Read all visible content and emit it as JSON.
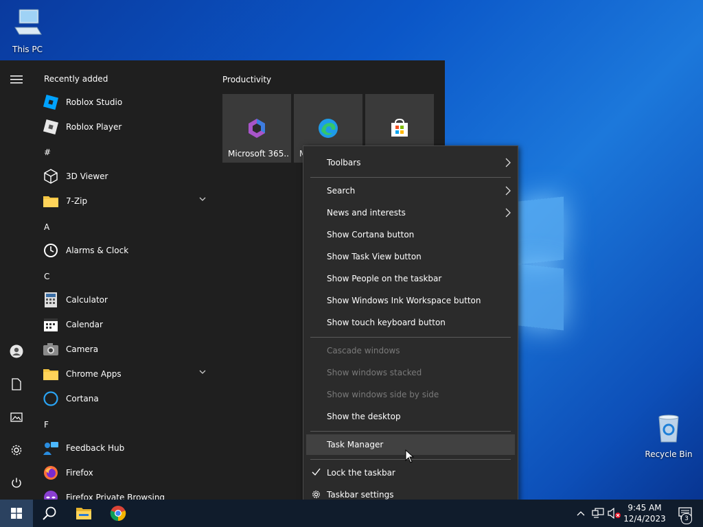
{
  "desktop": {
    "this_pc_label": "This PC",
    "recycle_bin_label": "Recycle Bin"
  },
  "start_menu": {
    "recently_added_header": "Recently added",
    "apps": [
      {
        "label": "Roblox Studio",
        "icon": "roblox-studio-icon"
      },
      {
        "label": "Roblox Player",
        "icon": "roblox-player-icon"
      },
      {
        "header": "#"
      },
      {
        "label": "3D Viewer",
        "icon": "cube-icon"
      },
      {
        "label": "7-Zip",
        "icon": "folder-icon",
        "expandable": true
      },
      {
        "header": "A"
      },
      {
        "label": "Alarms & Clock",
        "icon": "clock-icon"
      },
      {
        "header": "C"
      },
      {
        "label": "Calculator",
        "icon": "calculator-icon"
      },
      {
        "label": "Calendar",
        "icon": "calendar-icon"
      },
      {
        "label": "Camera",
        "icon": "camera-icon"
      },
      {
        "label": "Chrome Apps",
        "icon": "folder-icon",
        "expandable": true
      },
      {
        "label": "Cortana",
        "icon": "cortana-icon"
      },
      {
        "header": "F"
      },
      {
        "label": "Feedback Hub",
        "icon": "feedback-icon"
      },
      {
        "label": "Firefox",
        "icon": "firefox-icon"
      },
      {
        "label": "Firefox Private Browsing",
        "icon": "firefox-private-icon"
      }
    ],
    "tiles_group_title": "Productivity",
    "tiles": [
      {
        "label": "Microsoft 365...",
        "icon": "microsoft-365-icon"
      },
      {
        "label": "M",
        "icon": "edge-icon"
      },
      {
        "label": "",
        "icon": "store-icon"
      }
    ]
  },
  "context_menu": {
    "items": [
      {
        "label": "Toolbars",
        "submenu": true
      },
      {
        "label": "Search",
        "submenu": true
      },
      {
        "label": "News and interests",
        "submenu": true
      },
      {
        "label": "Show Cortana button"
      },
      {
        "label": "Show Task View button"
      },
      {
        "label": "Show People on the taskbar"
      },
      {
        "label": "Show Windows Ink Workspace button"
      },
      {
        "label": "Show touch keyboard button"
      },
      {
        "label": "Cascade windows",
        "disabled": true
      },
      {
        "label": "Show windows stacked",
        "disabled": true
      },
      {
        "label": "Show windows side by side",
        "disabled": true
      },
      {
        "label": "Show the desktop"
      },
      {
        "label": "Task Manager",
        "hovered": true
      },
      {
        "label": "Lock the taskbar",
        "checked": true
      },
      {
        "label": "Taskbar settings",
        "icon": "gear-icon"
      }
    ]
  },
  "taskbar": {
    "time": "9:45 AM",
    "date": "12/4/2023",
    "notification_count": "3"
  },
  "colors": {
    "menu_bg": "#2b2b2b",
    "start_bg": "#1f1f1f",
    "taskbar_bg": "#101c2c",
    "accent": "#0078d7"
  }
}
